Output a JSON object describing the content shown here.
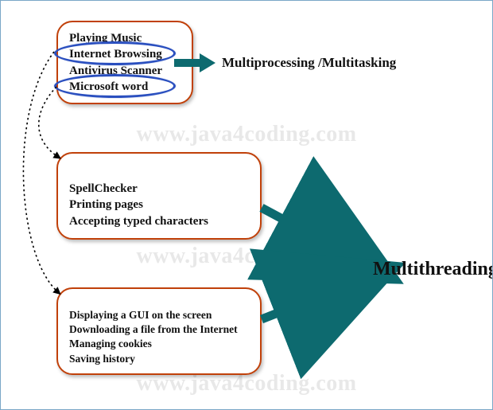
{
  "watermark": "www.java4coding.com",
  "labels": {
    "multiprocessing": "Multiprocessing /Multitasking",
    "multithreading": "Multithreading"
  },
  "box1": {
    "items": [
      "Playing Music",
      "Internet Browsing",
      "Antivirus Scanner",
      "Microsoft word"
    ]
  },
  "box2": {
    "items": [
      "SpellChecker",
      "Printing pages",
      "Accepting typed characters"
    ]
  },
  "box3": {
    "items": [
      "Displaying a GUI on the screen",
      "Downloading a file from the Internet",
      "Managing cookies",
      "Saving history"
    ]
  }
}
